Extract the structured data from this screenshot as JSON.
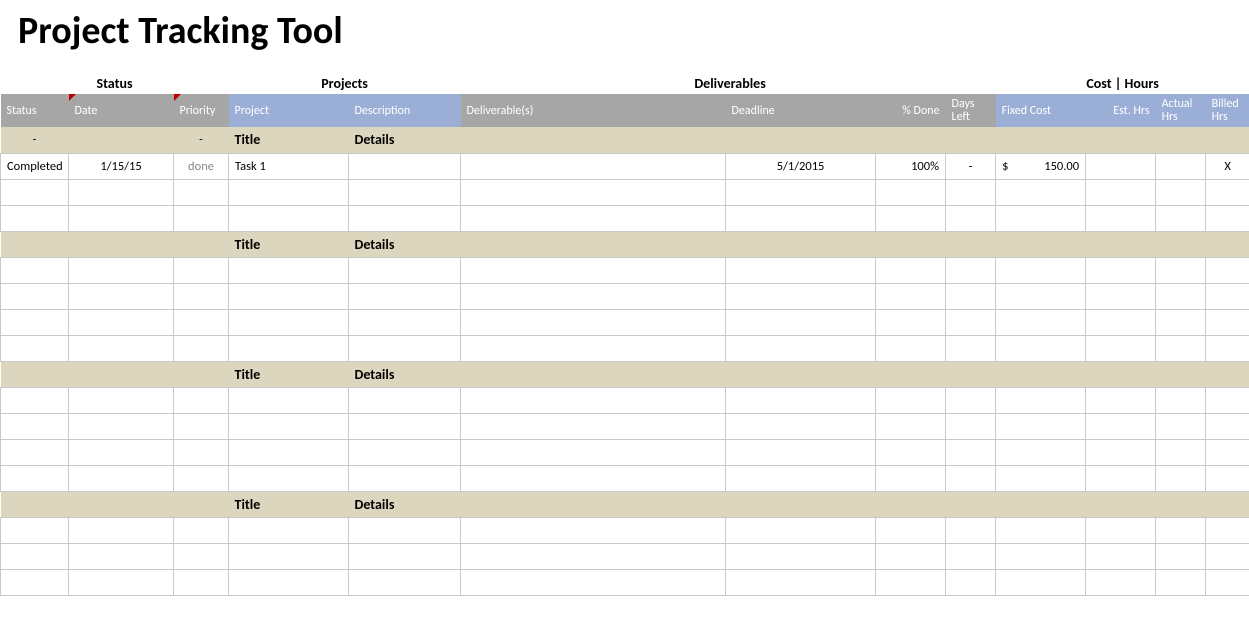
{
  "title": "Project Tracking Tool",
  "sections": {
    "status": "Status",
    "projects": "Projects",
    "deliverables": "Deliverables",
    "cost_hours": "Cost | Hours"
  },
  "headers": {
    "status": "Status",
    "date": "Date",
    "priority": "Priority",
    "project": "Project",
    "description": "Description",
    "deliverables": "Deliverable(s)",
    "deadline": "Deadline",
    "pct_done": "% Done",
    "days_left": "Days Left",
    "fixed_cost": "Fixed Cost",
    "est_hrs": "Est. Hrs",
    "actual_hrs": "Actual Hrs",
    "billed_hrs": "Billed Hrs"
  },
  "group": {
    "title_label": "Title",
    "details_label": "Details",
    "blank_dash": "-"
  },
  "rows": {
    "r1": {
      "status": "Completed",
      "date": "1/15/15",
      "priority": "done",
      "project": "Task 1",
      "description": "",
      "deliverables": "",
      "deadline": "5/1/2015",
      "pct_done": "100%",
      "days_left": "-",
      "fixed_cost_sym": "$",
      "fixed_cost_val": "150.00",
      "est_hrs": "",
      "actual_hrs": "",
      "billed_hrs": "X"
    }
  }
}
